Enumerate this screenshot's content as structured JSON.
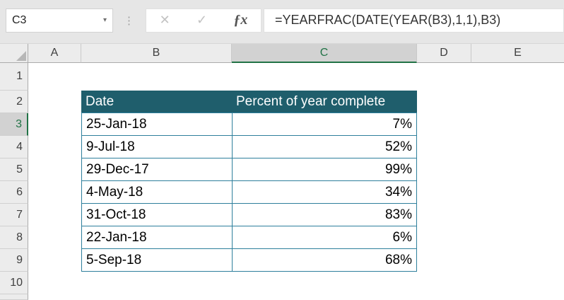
{
  "formula_bar": {
    "name_box": "C3",
    "name_box_arrow": "▾",
    "dots": "⋮",
    "cancel_icon": "✕",
    "enter_icon": "✓",
    "fx_icon": "ƒx",
    "formula": "=YEARFRAC(DATE(YEAR(B3),1,1),B3)"
  },
  "columns": [
    "A",
    "B",
    "C",
    "D",
    "E"
  ],
  "row_numbers": [
    "1",
    "2",
    "3",
    "4",
    "5",
    "6",
    "7",
    "8",
    "9",
    "10"
  ],
  "selection": {
    "active_cell": "C3",
    "selected_column": "C",
    "selected_row": "3",
    "active_cell_value": "7%"
  },
  "table": {
    "header": {
      "date": "Date",
      "percent": "Percent of year complete"
    },
    "rows": [
      {
        "date": "25-Jan-18",
        "percent": "7%"
      },
      {
        "date": "9-Jul-18",
        "percent": "52%"
      },
      {
        "date": "29-Dec-17",
        "percent": "99%"
      },
      {
        "date": "4-May-18",
        "percent": "34%"
      },
      {
        "date": "31-Oct-18",
        "percent": "83%"
      },
      {
        "date": "22-Jan-18",
        "percent": "6%"
      },
      {
        "date": "5-Sep-18",
        "percent": "68%"
      }
    ]
  },
  "colors": {
    "table_header_bg": "#1f5e6c",
    "table_border": "#2e7f9c",
    "selection_green": "#217346"
  }
}
